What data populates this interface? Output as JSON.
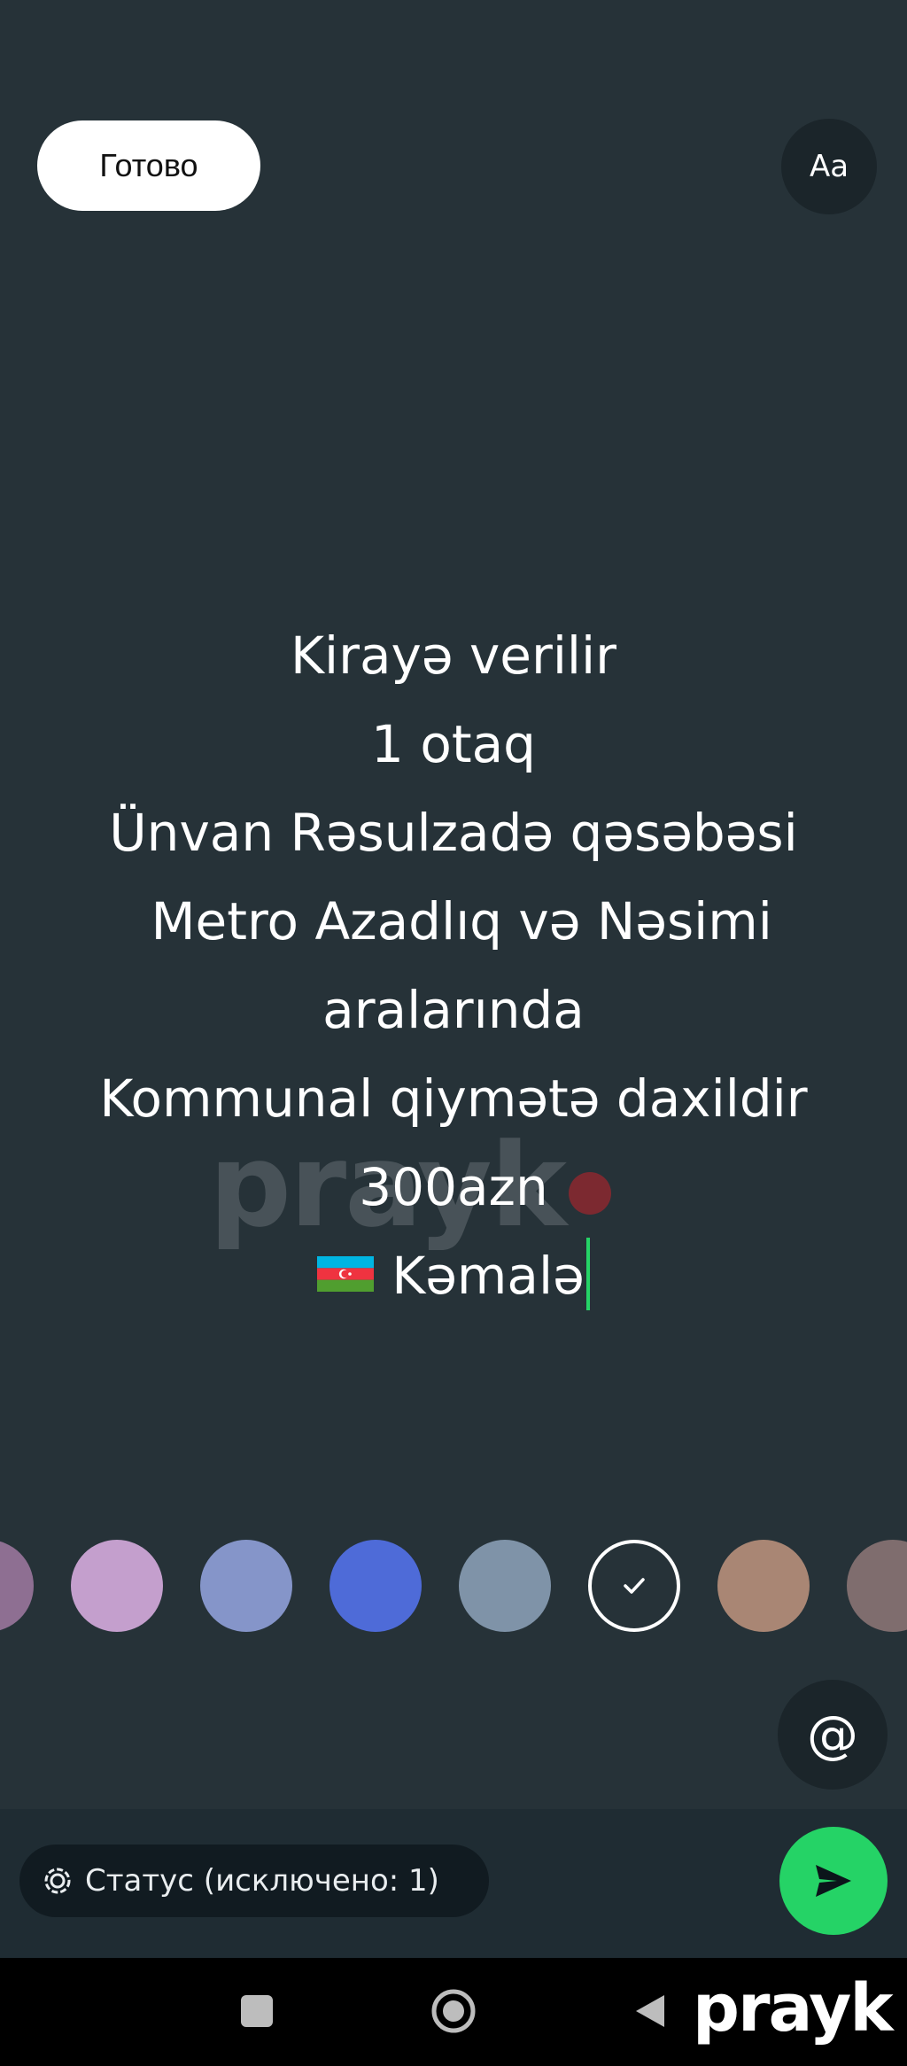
{
  "header": {
    "done_label": "Готово",
    "font_label": "Aa"
  },
  "editor": {
    "lines": [
      "Kirayə verilir",
      "1 otaq",
      "Ünvan Rəsulzadə qəsəbəsi",
      " Metro Azadlıq və Nəsimi",
      "aralarında",
      "Kommunal qiymətə daxildir",
      "300azn"
    ],
    "last_line_text": "Kəmalə",
    "flag_icon": "azerbaijan-flag-icon",
    "caret_color": "#25d366"
  },
  "watermark": {
    "text": "prayk",
    "brand_text": "prayk",
    "dot_color": "#e3242b"
  },
  "palette": {
    "colors": [
      "#8e6f92",
      "#c49fcd",
      "#8595c9",
      "#4e6bd8",
      "#7f93a8",
      "#263238",
      "#a98674",
      "#7f6d6e"
    ],
    "selected_index": 5
  },
  "mention": {
    "icon": "at-sign-icon",
    "label": "@"
  },
  "composer": {
    "status_label": "Статус (исключено: 1)",
    "status_icon": "status-ring-icon",
    "send_icon": "send-icon",
    "send_color": "#25d366"
  },
  "navigation": {
    "recent_icon": "square-icon",
    "home_icon": "circle-home-icon",
    "back_icon": "triangle-back-icon"
  }
}
